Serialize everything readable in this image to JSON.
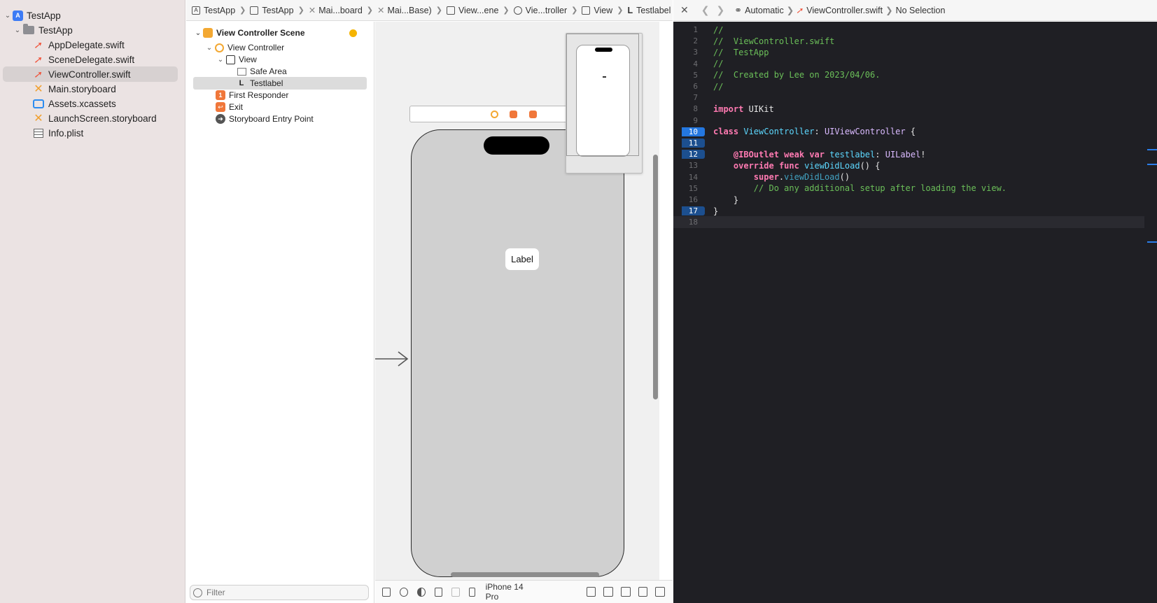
{
  "navigator": {
    "project": "TestApp",
    "group": "TestApp",
    "files": [
      {
        "name": "AppDelegate.swift",
        "type": "swift"
      },
      {
        "name": "SceneDelegate.swift",
        "type": "swift"
      },
      {
        "name": "ViewController.swift",
        "type": "swift",
        "selected": true
      },
      {
        "name": "Main.storyboard",
        "type": "storyboard"
      },
      {
        "name": "Assets.xcassets",
        "type": "assets"
      },
      {
        "name": "LaunchScreen.storyboard",
        "type": "storyboard"
      },
      {
        "name": "Info.plist",
        "type": "plist"
      }
    ]
  },
  "breadcrumb": {
    "items": [
      "TestApp",
      "TestApp",
      "Mai...board",
      "Mai...Base)",
      "View...ene",
      "Vie...troller",
      "View",
      "Testlabel"
    ]
  },
  "outline": {
    "scene": "View Controller Scene",
    "view_controller": "View Controller",
    "view": "View",
    "safe_area": "Safe Area",
    "label": "Testlabel",
    "first_responder": "First Responder",
    "exit": "Exit",
    "entry_point": "Storyboard Entry Point",
    "filter_placeholder": "Filter"
  },
  "canvas": {
    "label_text": "Label"
  },
  "canvas_toolbar": {
    "device": "iPhone 14 Pro"
  },
  "editor": {
    "jumpbar": {
      "mode": "Automatic",
      "file": "ViewController.swift",
      "selection": "No Selection"
    },
    "lines": [
      {
        "n": "1",
        "html": "<span class=\"cm\">//</span>"
      },
      {
        "n": "2",
        "html": "<span class=\"cm\">//  ViewController.swift</span>"
      },
      {
        "n": "3",
        "html": "<span class=\"cm\">//  TestApp</span>"
      },
      {
        "n": "4",
        "html": "<span class=\"cm\">//</span>"
      },
      {
        "n": "5",
        "html": "<span class=\"cm\">//  Created by Lee on 2023/04/06.</span>"
      },
      {
        "n": "6",
        "html": "<span class=\"cm\">//</span>"
      },
      {
        "n": "7",
        "html": ""
      },
      {
        "n": "8",
        "html": "<span class=\"kw\">import</span> UIKit"
      },
      {
        "n": "9",
        "html": ""
      },
      {
        "n": "10",
        "html": "<span class=\"kw\">class</span> <span class=\"dec\">ViewController</span>: <span class=\"ty\">UIViewController</span> {",
        "bp": "active"
      },
      {
        "n": "11",
        "html": "",
        "bp": "on"
      },
      {
        "n": "12",
        "html": "    <span class=\"attr\">@IBOutlet</span> <span class=\"kw\">weak</span> <span class=\"kw\">var</span> <span class=\"dec\">testlabel</span>: <span class=\"ty\">UILabel</span>!",
        "bp": "on"
      },
      {
        "n": "13",
        "html": "    <span class=\"kw\">override</span> <span class=\"kw\">func</span> <span class=\"dec\">viewDidLoad</span>() {"
      },
      {
        "n": "14",
        "html": "        <span class=\"kw\">super</span>.<span class=\"fn\">viewDidLoad</span>()"
      },
      {
        "n": "15",
        "html": "        <span class=\"cm\">// Do any additional setup after loading the view.</span>"
      },
      {
        "n": "16",
        "html": "    }"
      },
      {
        "n": "17",
        "html": "}",
        "bp": "on"
      },
      {
        "n": "18",
        "html": "",
        "current": true
      }
    ]
  }
}
